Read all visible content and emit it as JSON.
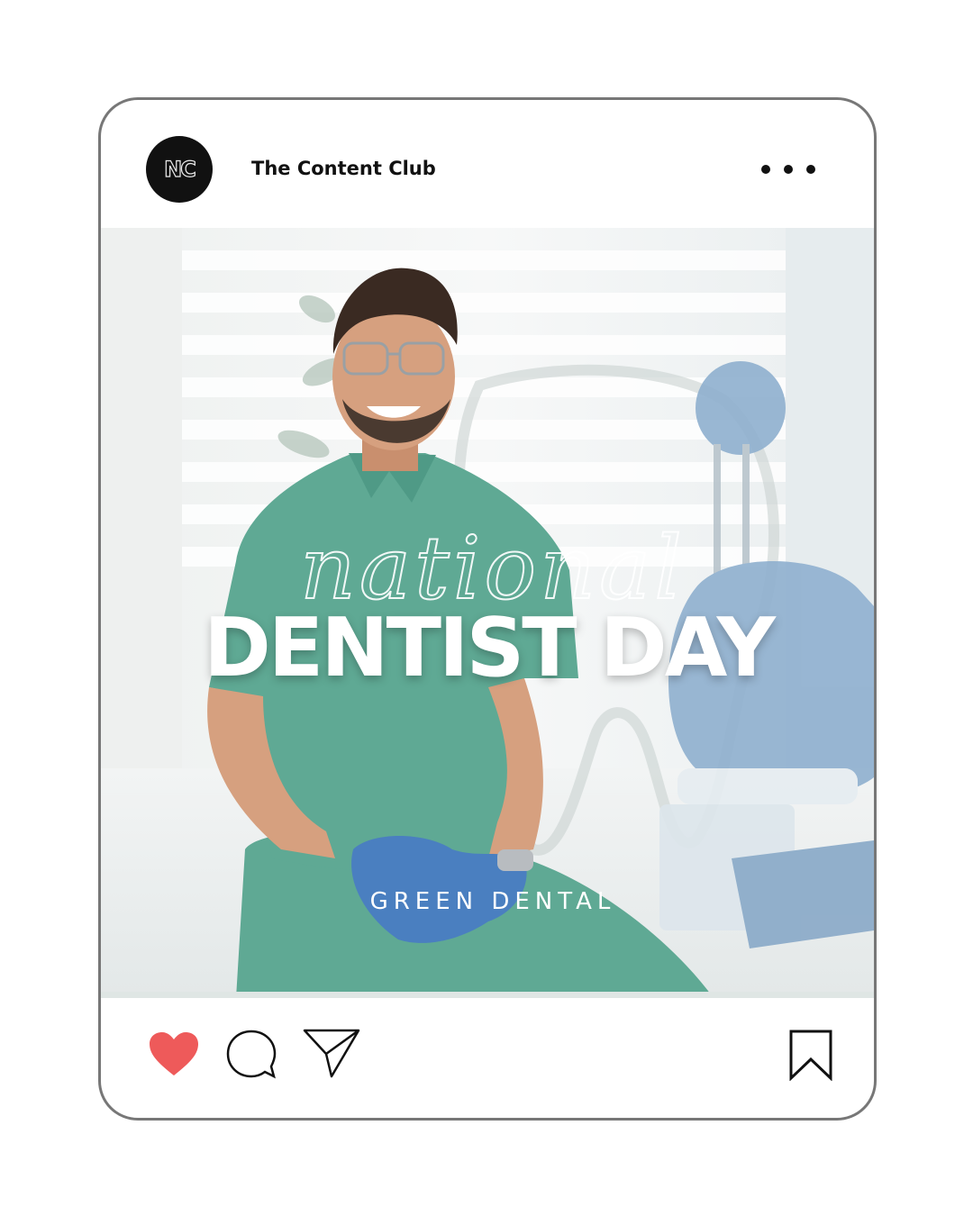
{
  "post": {
    "account": {
      "name": "The Content Club",
      "avatar_text": "NC"
    },
    "image": {
      "script_title": "national",
      "main_title": "DENTIST DAY",
      "brand": "GREEN DENTAL"
    },
    "actions": {
      "liked": true
    }
  },
  "colors": {
    "frame_border": "#777777",
    "like": "#ee5a5a",
    "scrubs": "#5fa994",
    "gloves": "#4a7fc0",
    "chair": "#8fb0cf"
  },
  "icons": {
    "more": "more-options-icon",
    "like": "heart-icon",
    "comment": "comment-icon",
    "share": "paper-plane-icon",
    "save": "bookmark-icon"
  }
}
